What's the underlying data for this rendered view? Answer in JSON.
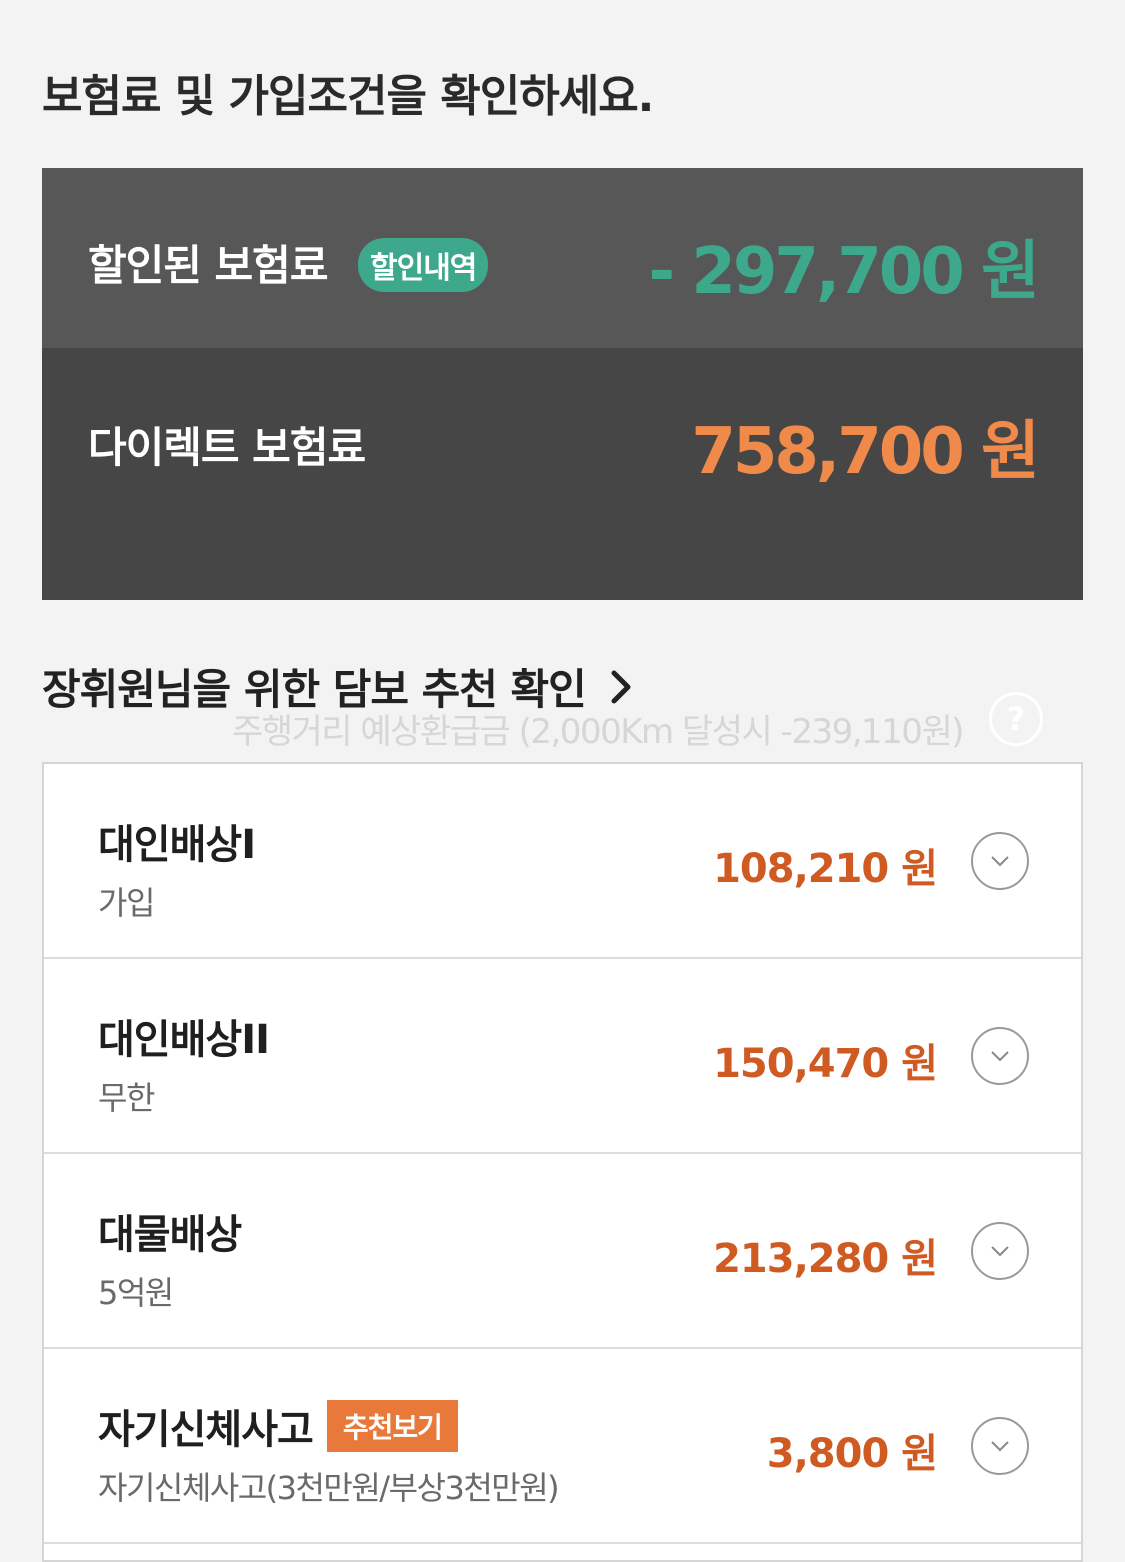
{
  "page_title": "보험료 및 가입조건을 확인하세요.",
  "summary": {
    "discount_label": "할인된 보험료",
    "discount_badge": "할인내역",
    "discount_amount": "- 297,700 원",
    "direct_label": "다이렉트 보험료",
    "direct_amount": "758,700 원",
    "refund_note": "주행거리 예상환급금 (2,000Km 달성시 -239,110원)",
    "help_symbol": "?"
  },
  "recommendation": {
    "link_text": "장휘원님을 위한 담보 추천 확인"
  },
  "coverages": [
    {
      "name": "대인배상I",
      "sub": "가입",
      "price": "108,210 원"
    },
    {
      "name": "대인배상II",
      "sub": "무한",
      "price": "150,470 원"
    },
    {
      "name": "대물배상",
      "sub": "5억원",
      "price": "213,280 원"
    },
    {
      "name": "자기신체사고",
      "badge": "추천보기",
      "sub": "자기신체사고(3천만원/부상3천만원)",
      "price": "3,800 원"
    }
  ],
  "colors": {
    "discount_green": "#3ea88c",
    "direct_orange": "#f08a4b",
    "price_orange": "#cf5a22",
    "badge_orange": "#e8793a"
  },
  "icons": {
    "help": "question-circle-icon",
    "recommendation": "chevron-right-icon",
    "expand": "chevron-down-circle-icon"
  }
}
